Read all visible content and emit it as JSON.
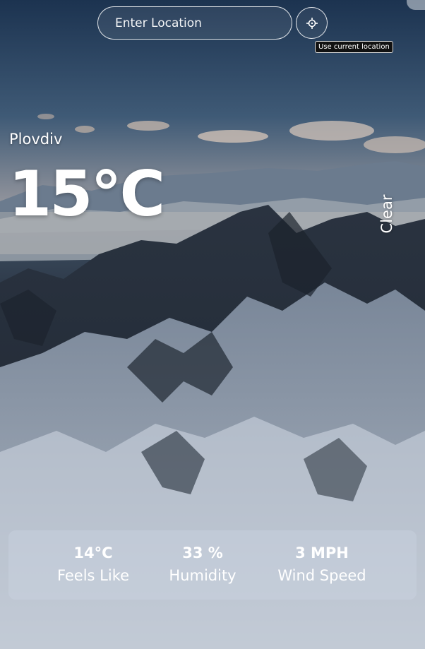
{
  "search": {
    "placeholder": "Enter Location",
    "value": ""
  },
  "locate": {
    "icon": "crosshair-icon",
    "tooltip": "Use current location"
  },
  "weather": {
    "city": "Plovdiv",
    "temperature": "15°C",
    "condition": "Clear"
  },
  "stats": {
    "feels_like": {
      "value": "14°C",
      "label": "Feels Like"
    },
    "humidity": {
      "value": "33 %",
      "label": "Humidity"
    },
    "wind_speed": {
      "value": "3 MPH",
      "label": "Wind Speed"
    }
  }
}
